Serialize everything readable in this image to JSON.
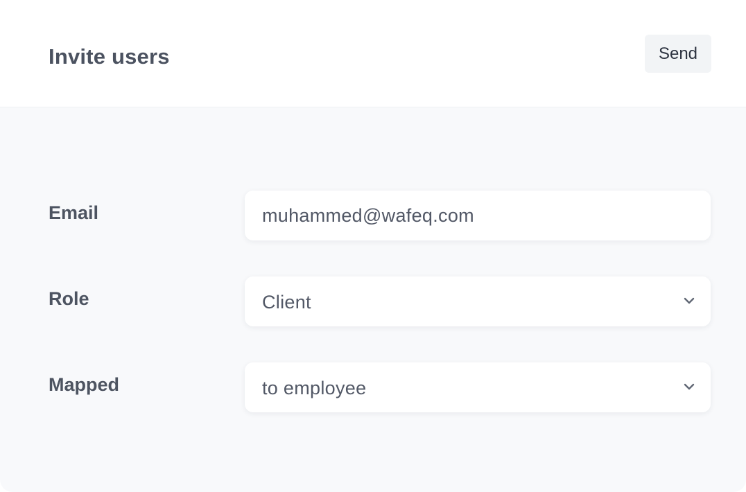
{
  "header": {
    "title": "Invite users",
    "send_label": "Send"
  },
  "form": {
    "email": {
      "label": "Email",
      "value": "muhammed@wafeq.com"
    },
    "role": {
      "label": "Role",
      "value": "Client"
    },
    "mapped": {
      "label": "Mapped",
      "value": "to employee"
    }
  },
  "icons": {
    "dropdown": "chevron-down-icon"
  },
  "colors": {
    "header_bg": "#ffffff",
    "body_bg": "#f8f9fb",
    "text": "#4b5260",
    "button_bg": "#f2f4f6"
  }
}
